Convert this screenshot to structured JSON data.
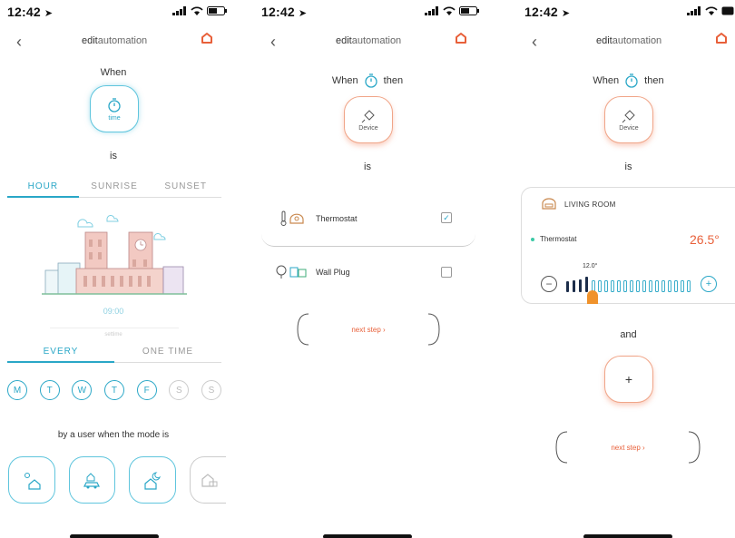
{
  "status": {
    "time": "12:42"
  },
  "screens": [
    {
      "nav": {
        "title_bold": "edit",
        "title_light": "automation"
      },
      "when_label": "When",
      "trigger_label": "time",
      "is_label": "is",
      "tabs": [
        {
          "label": "HOUR",
          "active": true
        },
        {
          "label": "SUNRISE",
          "active": false
        },
        {
          "label": "SUNSET",
          "active": false
        }
      ],
      "time_value": "09:00",
      "time_caption": "settime",
      "repeat_tabs": [
        {
          "label": "EVERY",
          "active": true
        },
        {
          "label": "ONE TIME",
          "active": false
        }
      ],
      "days": [
        {
          "label": "M",
          "on": true
        },
        {
          "label": "T",
          "on": true
        },
        {
          "label": "W",
          "on": true
        },
        {
          "label": "T",
          "on": true
        },
        {
          "label": "F",
          "on": true
        },
        {
          "label": "S",
          "on": false
        },
        {
          "label": "S",
          "on": false
        }
      ],
      "mode_text": "by a user when the mode is",
      "modes": [
        {
          "icon": "home-day-icon",
          "on": true
        },
        {
          "icon": "away-car-icon",
          "on": true
        },
        {
          "icon": "home-night-icon",
          "on": true
        },
        {
          "icon": "vacation-icon",
          "on": false
        }
      ]
    },
    {
      "nav": {
        "title_bold": "edit",
        "title_light": "automation"
      },
      "when_label": "When",
      "then_label": "then",
      "trigger_label": "Device",
      "is_label": "is",
      "devices": [
        {
          "name": "Thermostat",
          "checked": true
        },
        {
          "name": "Wall Plug",
          "checked": false
        }
      ],
      "check_mark": "✓",
      "next_step": "next step ›"
    },
    {
      "nav": {
        "title_bold": "edit",
        "title_light": "automation"
      },
      "when_label": "When",
      "then_label": "then",
      "trigger_label": "Device",
      "is_label": "is",
      "room": "LIVING ROOM",
      "device_name": "Thermostat",
      "temperature": "26.5°",
      "set_point": "12.0°",
      "minus": "−",
      "plus": "+",
      "and_label": "and",
      "add_label": "+",
      "next_step": "next step ›"
    }
  ],
  "colors": {
    "accent_blue": "#2aa7c7",
    "accent_orange": "#e8603a"
  }
}
